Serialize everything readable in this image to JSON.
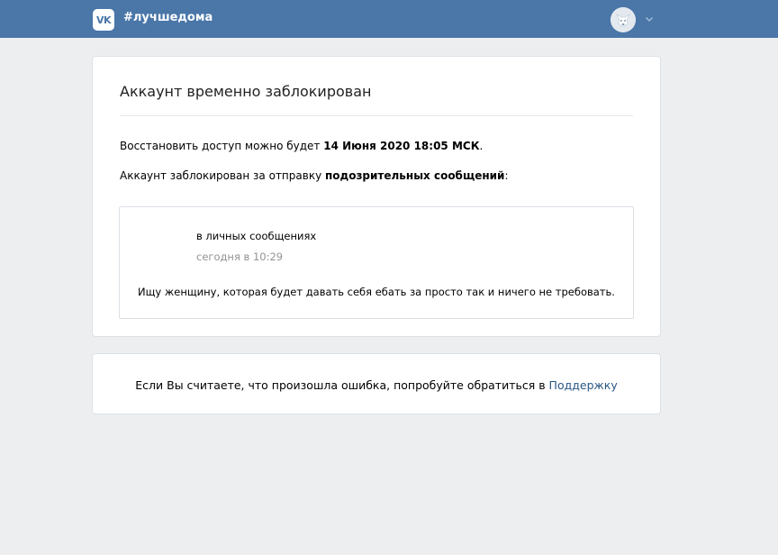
{
  "header": {
    "logo_text": "VK",
    "brand": "#лучшедома",
    "logo_icon": "vk-logo-icon",
    "avatar_icon": "dog-avatar-icon",
    "menu_icon": "chevron-down-icon"
  },
  "block": {
    "title": "Аккаунт временно заблокирован",
    "restore_prefix": "Восстановить доступ можно будет ",
    "restore_date": "14 Июня 2020 18:05 МСК",
    "restore_suffix": ".",
    "reason_prefix": "Аккаунт заблокирован за отправку ",
    "reason_bold": "подозрительных сообщений",
    "reason_suffix": ":"
  },
  "message": {
    "place": "в личных сообщениях",
    "time": "сегодня в 10:29",
    "text": "Ищу женщину, которая будет давать себя ебать за просто так и ничего не требовать."
  },
  "support": {
    "text": "Если Вы считаете, что произошла ошибка, попробуйте обратиться в ",
    "link": "Поддержку"
  },
  "colors": {
    "header_bg": "#4a76a8",
    "page_bg": "#edeef0",
    "link": "#2a5885",
    "muted": "#939393"
  }
}
